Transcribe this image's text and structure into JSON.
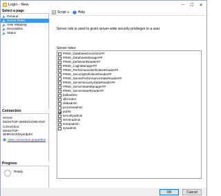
{
  "window": {
    "title": "Login - New",
    "minimize_glyph": "─",
    "maximize_glyph": "☐",
    "close_glyph": "✕"
  },
  "sidebar": {
    "header": "Select a page",
    "pages": [
      {
        "label": "General",
        "selected": false
      },
      {
        "label": "Server Roles",
        "selected": true
      },
      {
        "label": "User Mapping",
        "selected": false
      },
      {
        "label": "Securables",
        "selected": false
      },
      {
        "label": "Status",
        "selected": false
      }
    ],
    "connection": {
      "header": "Connection",
      "server_label": "Server:",
      "server_value": "DESKTOP-2E6R4G4\\REYNO",
      "connection_label": "Connection:",
      "connection_value": "DESKTOP-2E6R4G4\\bzyerdp04",
      "view_link": "View connection properties"
    },
    "progress": {
      "header": "Progress",
      "status": "Ready"
    }
  },
  "toolbar": {
    "script_label": "Script",
    "help_label": "Help"
  },
  "main": {
    "description": "Server role is used to grant server-wide security privileges to a user.",
    "roles_label": "Server roles:",
    "roles": [
      {
        "name": "##MS_DatabaseConnector##",
        "checked": false
      },
      {
        "name": "##MS_DatabaseManager##",
        "checked": false
      },
      {
        "name": "##MS_DefinitionReader##",
        "checked": false
      },
      {
        "name": "##MS_LoginManager##",
        "checked": false
      },
      {
        "name": "##MS_PerformanceDefinitionReader##",
        "checked": false
      },
      {
        "name": "##MS_SecurityDefinitionReader##",
        "checked": false
      },
      {
        "name": "##MS_ServerPerformanceStateReader##",
        "checked": false
      },
      {
        "name": "##MS_ServerSecurityStateReader##",
        "checked": false
      },
      {
        "name": "##MS_ServerStateManager##",
        "checked": false
      },
      {
        "name": "##MS_ServerStateReader##",
        "checked": false
      },
      {
        "name": "bulkadmin",
        "checked": false
      },
      {
        "name": "dbcreator",
        "checked": false
      },
      {
        "name": "diskadmin",
        "checked": false
      },
      {
        "name": "processadmin",
        "checked": false
      },
      {
        "name": "public",
        "checked": true
      },
      {
        "name": "securityadmin",
        "checked": false
      },
      {
        "name": "serveradmin",
        "checked": false
      },
      {
        "name": "setupadmin",
        "checked": false
      },
      {
        "name": "sysadmin",
        "checked": false
      }
    ]
  },
  "footer": {
    "ok_label": "OK",
    "cancel_label": "Cancel"
  },
  "colors": {
    "selection": "#3399ff",
    "link": "#0645ad",
    "default_button_border": "#0078d7"
  }
}
